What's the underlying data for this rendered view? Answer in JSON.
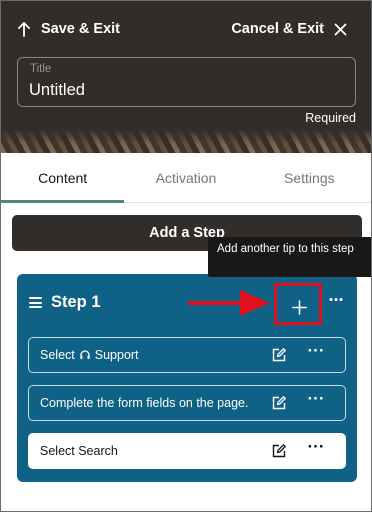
{
  "header": {
    "save_exit_label": "Save & Exit",
    "cancel_exit_label": "Cancel & Exit",
    "title_field": {
      "label": "Title",
      "value": "Untitled"
    },
    "required_label": "Required"
  },
  "tabs": [
    {
      "label": "Content",
      "active": true
    },
    {
      "label": "Activation",
      "active": false
    },
    {
      "label": "Settings",
      "active": false
    }
  ],
  "add_step_label": "Add a Step",
  "tooltip_text": "Add another tip to this step",
  "step": {
    "title": "Step 1",
    "more_label": "···",
    "tips": [
      {
        "text_before_icon": "Select",
        "icon": "headset-icon",
        "text_after_icon": "Support",
        "style": "dark"
      },
      {
        "text": "Complete the form fields on the page.",
        "style": "dark"
      },
      {
        "text": "Select Search",
        "style": "light"
      }
    ],
    "tip_more_label": "···"
  },
  "colors": {
    "header_bg": "#312d2a",
    "step_card_bg": "#0f6285",
    "active_tab_underline": "#4e8a6b",
    "highlight_red": "#e0111a"
  }
}
